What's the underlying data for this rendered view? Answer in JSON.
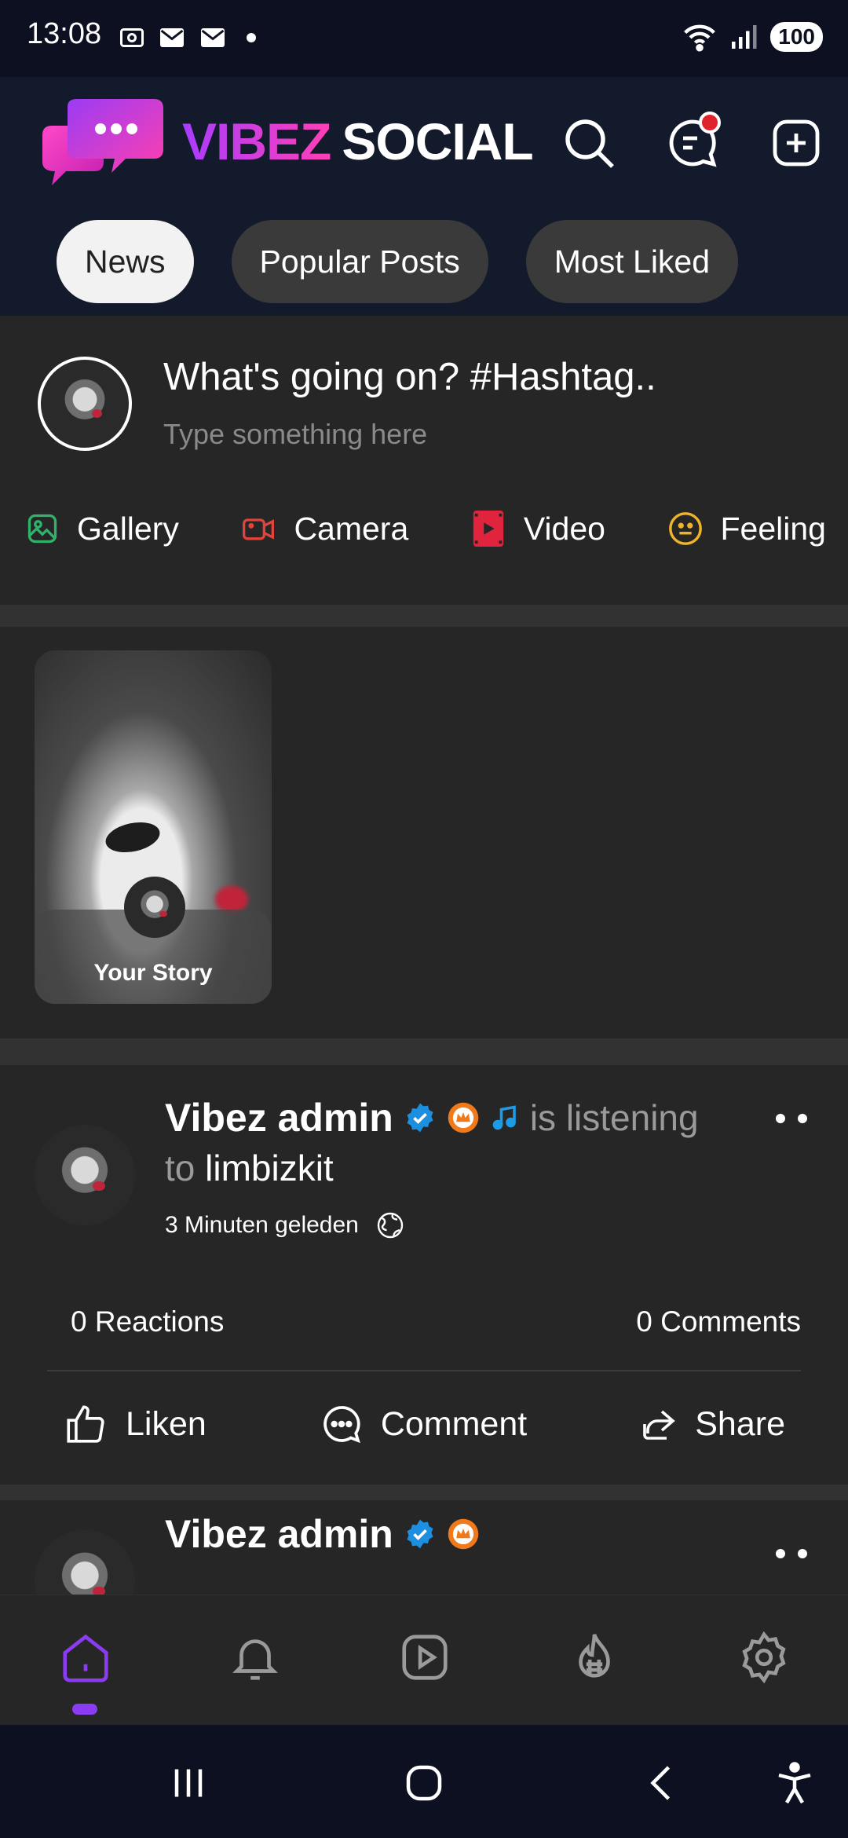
{
  "status_bar": {
    "time": "13:08",
    "battery": "100"
  },
  "header": {
    "brand_part1": "VIBEZ",
    "brand_part2": "SOCIAL"
  },
  "tabs": [
    {
      "label": "News",
      "active": true
    },
    {
      "label": "Popular Posts",
      "active": false
    },
    {
      "label": "Most Liked",
      "active": false
    }
  ],
  "composer": {
    "title": "What's going on? #Hashtag..",
    "placeholder": "Type something here",
    "actions": [
      {
        "label": "Gallery",
        "icon": "gallery-icon",
        "color": "#2fb36b"
      },
      {
        "label": "Camera",
        "icon": "camera-icon",
        "color": "#e0443a"
      },
      {
        "label": "Video",
        "icon": "video-icon",
        "color": "#e0243e"
      },
      {
        "label": "Feeling",
        "icon": "feeling-icon",
        "color": "#f0b429"
      }
    ]
  },
  "stories": [
    {
      "label": "Your Story"
    }
  ],
  "posts": [
    {
      "author": "Vibez admin",
      "activity": "is listening",
      "activity_to": "to",
      "track": "limbizkit",
      "time": "3 Minuten geleden",
      "reactions": "0 Reactions",
      "comments": "0 Comments",
      "actions": {
        "like": "Liken",
        "comment": "Comment",
        "share": "Share"
      }
    },
    {
      "author": "Vibez admin"
    }
  ],
  "colors": {
    "accent": "#8b3cf0",
    "verified": "#1d8fe0",
    "badge": "#f07a1a",
    "notification": "#e0242e"
  }
}
